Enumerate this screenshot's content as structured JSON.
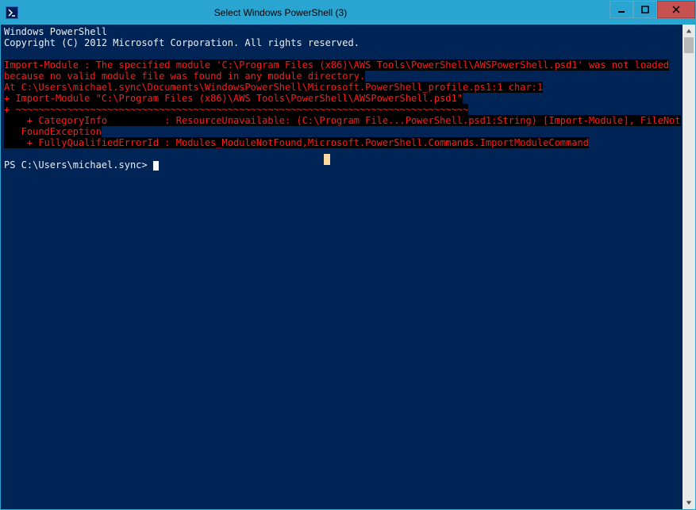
{
  "titlebar": {
    "title": "Select Windows PowerShell (3)"
  },
  "console": {
    "header1": "Windows PowerShell",
    "header2": "Copyright (C) 2012 Microsoft Corporation. All rights reserved.",
    "err1": "Import-Module : The specified module 'C:\\Program Files (x86)\\AWS Tools\\PowerShell\\AWSPowerShell.psd1' was not loaded",
    "err2": "because no valid module file was found in any module directory.",
    "err3": "At C:\\Users\\michael.sync\\Documents\\WindowsPowerShell\\Microsoft.PowerShell_profile.ps1:1 char:1",
    "err4": "+ Import-Module \"C:\\Program Files (x86)\\AWS Tools\\PowerShell\\AWSPowerShell.psd1\"",
    "err5": "+ ~~~~~~~~~~~~~~~~~~~~~~~~~~~~~~~~~~~~~~~~~~~~~~~~~~~~~~~~~~~~~~~~~~~~~~~~~~~~~~~",
    "err6": "    + CategoryInfo          : ResourceUnavailable: (C:\\Program File...PowerShell.psd1:String) [Import-Module], FileNot",
    "err7": "   FoundException",
    "err8": "    + FullyQualifiedErrorId : Modules_ModuleNotFound,Microsoft.PowerShell.Commands.ImportModuleCommand",
    "prompt": "PS C:\\Users\\michael.sync> "
  }
}
